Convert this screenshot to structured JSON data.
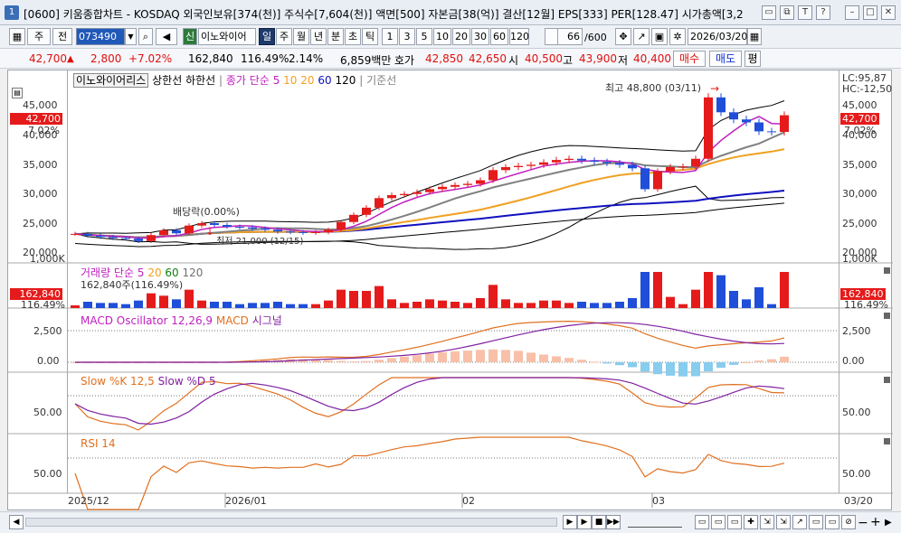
{
  "window": {
    "number": "1",
    "title": "[0600] 키움종합차트 - KOSDAQ 외국인보유[374(천)] 주식수[7,604(천)] 액면[500] 자본금[38(억)] 결산[12월] EPS[333] PER[128.47] 시가총액[3,2"
  },
  "toolbar": {
    "period_1": "주",
    "period_2": "전",
    "code": "073490",
    "badge": "신",
    "stock_name": "이노와이어",
    "tabs": [
      "일",
      "주",
      "월",
      "년",
      "분",
      "초",
      "틱"
    ],
    "intervals": [
      "1",
      "3",
      "5",
      "10",
      "20",
      "30",
      "60",
      "120"
    ],
    "count": "66",
    "count_total": "/600",
    "date": "2026/03/20"
  },
  "quote": {
    "price": "42,700",
    "arrow": "▲",
    "change": "2,800",
    "change_pct": "+7.02%",
    "volume": "162,840",
    "vol_ratio": "116.49%",
    "turnover": "2.14%",
    "amount": "6,859백만",
    "bid_label": "호가",
    "bid1": "42,850",
    "bid2": "42,650",
    "open_label": "시",
    "open": "40,500",
    "high_label": "고",
    "high": "43,900",
    "low_label": "저",
    "low": "40,400",
    "buy": "매수",
    "sell": "매도",
    "eval": "평"
  },
  "price_pane": {
    "legend_name": "이노와이어리스",
    "legend_upper": "상한선",
    "legend_lower": "하한선",
    "legend_ma": "종가 단순",
    "ma_periods": [
      "5",
      "10",
      "20",
      "60",
      "120"
    ],
    "legend_base": "기준선",
    "lc": "LC:95,87",
    "hc": "HC:-12,50",
    "y_ticks": [
      "45,000",
      "40,000",
      "35,000",
      "30,000",
      "25,000",
      "20,000"
    ],
    "price_box": "42,700",
    "pct_box": "7.02%",
    "high_annot": "최고 48,800 (03/11)",
    "low_annot": "최저 21,000 (12/15)",
    "dividend_annot": "배당락(0.00%)"
  },
  "volume_pane": {
    "legend": "거래량 단순",
    "periods": [
      "5",
      "20",
      "60",
      "120"
    ],
    "current": "162,840주(116.49%)",
    "y_tick": "1,000K",
    "box": "162,840",
    "box_pct": "116.49%"
  },
  "macd_pane": {
    "legend_osc": "MACD Oscillator 12,26,9",
    "legend_macd": "MACD",
    "legend_signal": "시그널",
    "y_ticks": [
      "2,500",
      "0.00"
    ]
  },
  "slow_pane": {
    "legend_k": "Slow %K 12,5",
    "legend_d": "Slow %D 5",
    "y_tick": "50.00"
  },
  "rsi_pane": {
    "legend": "RSI 14",
    "y_tick": "50.00"
  },
  "x_axis": [
    "2025/12",
    "2026/01",
    "02",
    "03",
    "03/20"
  ],
  "colors": {
    "up": "#e51b1b",
    "down": "#1f4ed8",
    "ma5": "#c020c0",
    "ma20": "#f0a020",
    "ma60": "#808080",
    "ma120": "#1010c0"
  },
  "chart_data": {
    "type": "line",
    "title": "",
    "candles_close": [
      22800,
      22500,
      22300,
      22100,
      22000,
      21600,
      22600,
      23400,
      22900,
      24200,
      24600,
      24300,
      24000,
      23900,
      23700,
      23500,
      23200,
      23100,
      23000,
      23100,
      23500,
      24800,
      26000,
      27200,
      28800,
      29300,
      29500,
      29800,
      30300,
      30700,
      31000,
      31200,
      31800,
      33500,
      34000,
      34200,
      34400,
      34800,
      35200,
      35400,
      35100,
      34900,
      34700,
      34400,
      33800,
      30300,
      33300,
      34000,
      34100,
      35400,
      45700,
      43200,
      42000,
      41500,
      40000,
      39900,
      42700
    ],
    "ylim": [
      19000,
      49000
    ]
  }
}
